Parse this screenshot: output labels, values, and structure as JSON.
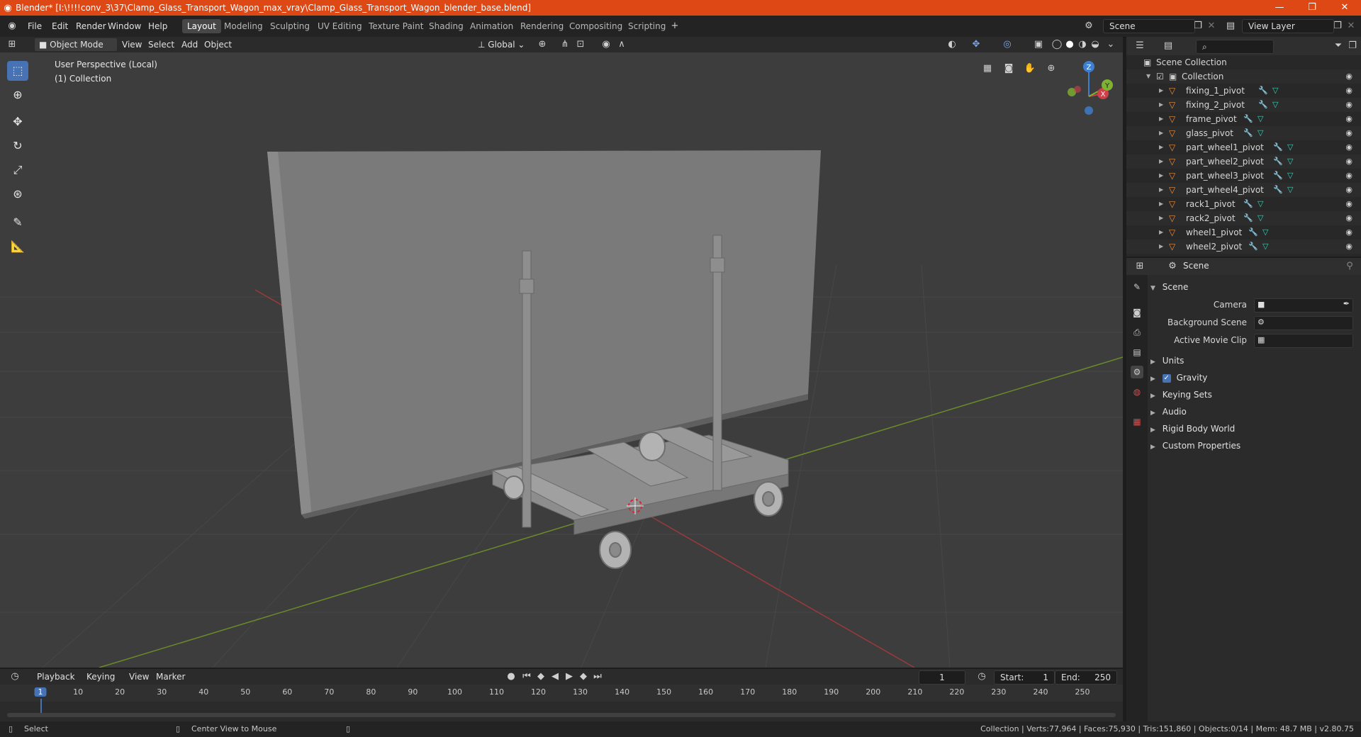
{
  "titlebar": {
    "title": "Blender* [I:\\!!!!conv_3\\37\\Clamp_Glass_Transport_Wagon_max_vray\\Clamp_Glass_Transport_Wagon_blender_base.blend]",
    "minimize": "—",
    "maximize": "❐",
    "close": "✕"
  },
  "menu": [
    "File",
    "Edit",
    "Render",
    "Window",
    "Help"
  ],
  "workspaces": [
    "Layout",
    "Modeling",
    "Sculpting",
    "UV Editing",
    "Texture Paint",
    "Shading",
    "Animation",
    "Rendering",
    "Compositing",
    "Scripting"
  ],
  "active_workspace": "Layout",
  "scene_field": "Scene",
  "view_layer_field": "View Layer",
  "viewport_header": {
    "mode": "Object Mode",
    "menus": [
      "View",
      "Select",
      "Add",
      "Object"
    ],
    "orientation": "Global"
  },
  "viewport": {
    "perspective": "User Perspective (Local)",
    "collection": "(1) Collection",
    "gizmo": {
      "x": "X",
      "y": "Y",
      "z": "Z"
    }
  },
  "outliner": {
    "search_placeholder": "",
    "root": "Scene Collection",
    "collection": "Collection",
    "items": [
      "fixing_1_pivot",
      "fixing_2_pivot",
      "frame_pivot",
      "glass_pivot",
      "part_wheel1_pivot",
      "part_wheel2_pivot",
      "part_wheel3_pivot",
      "part_wheel4_pivot",
      "rack1_pivot",
      "rack2_pivot",
      "wheel1_pivot",
      "wheel2_pivot"
    ]
  },
  "properties": {
    "header": "Scene",
    "panel": "Scene",
    "fields": {
      "camera": "Camera",
      "background_scene": "Background Scene",
      "active_movie_clip": "Active Movie Clip"
    },
    "sections": [
      "Units",
      "Gravity",
      "Keying Sets",
      "Audio",
      "Rigid Body World",
      "Custom Properties"
    ],
    "gravity_checked": true
  },
  "timeline": {
    "menus": [
      "Playback",
      "Keying",
      "View",
      "Marker"
    ],
    "current_frame": "1",
    "start_label": "Start:",
    "start": "1",
    "end_label": "End:",
    "end": "250",
    "ruler": [
      "1",
      "10",
      "20",
      "30",
      "40",
      "50",
      "60",
      "70",
      "80",
      "90",
      "100",
      "110",
      "120",
      "130",
      "140",
      "150",
      "160",
      "170",
      "180",
      "190",
      "200",
      "210",
      "220",
      "230",
      "240",
      "250"
    ]
  },
  "statusbar": {
    "left_action": "Select",
    "middle_action": "Center View to Mouse",
    "stats": "Collection | Verts:77,964 | Faces:75,930 | Tris:151,860 | Objects:0/14 | Mem: 48.7 MB | v2.80.75"
  },
  "colors": {
    "titlebar": "#de4815",
    "accent": "#4772b3",
    "object_icon": "#e79040",
    "mesh_icon": "#3ccfb5"
  }
}
